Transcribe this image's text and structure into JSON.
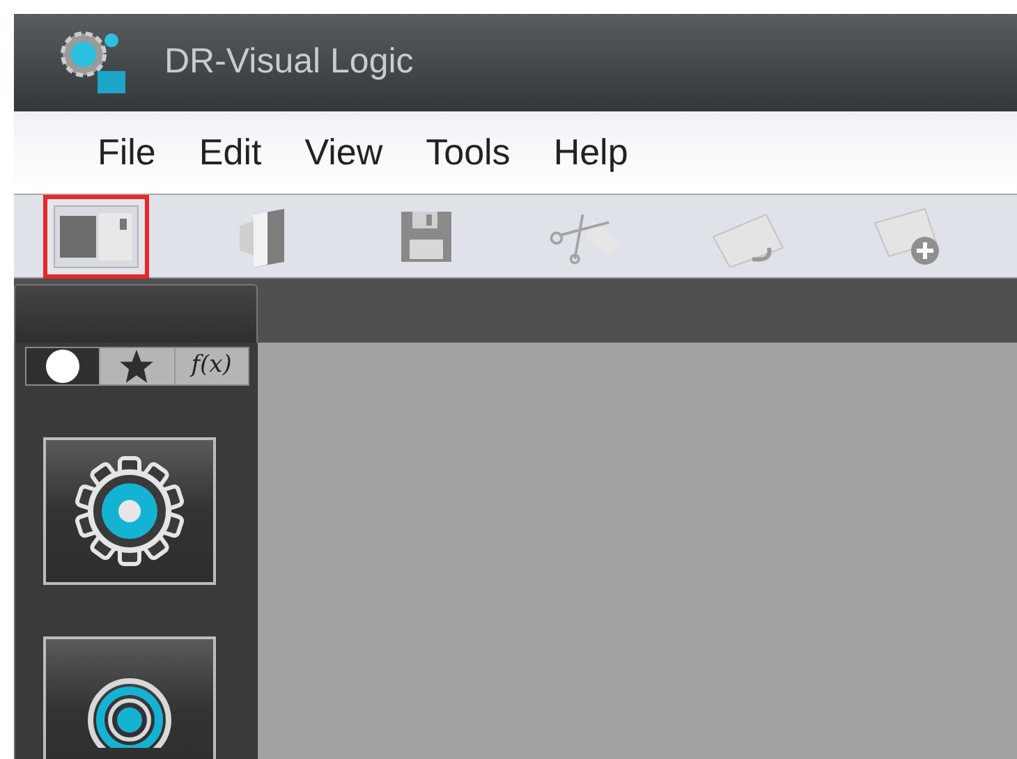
{
  "window": {
    "title": "DR-Visual Logic"
  },
  "menu": [
    "File",
    "Edit",
    "View",
    "Tools",
    "Help"
  ],
  "toolbar": [
    {
      "kind": "layout",
      "highlighted": true
    },
    {
      "kind": "book",
      "highlighted": false
    },
    {
      "kind": "save",
      "highlighted": false
    },
    {
      "kind": "cut",
      "highlighted": false
    },
    {
      "kind": "paste",
      "highlighted": false
    },
    {
      "kind": "add",
      "highlighted": false
    }
  ],
  "palette_tabs": [
    {
      "kind": "circle",
      "selected": true
    },
    {
      "kind": "star",
      "selected": false
    },
    {
      "kind": "text",
      "label": "f(x)",
      "selected": false
    }
  ],
  "palette_items": [
    {
      "kind": "gear"
    },
    {
      "kind": "signal"
    }
  ]
}
